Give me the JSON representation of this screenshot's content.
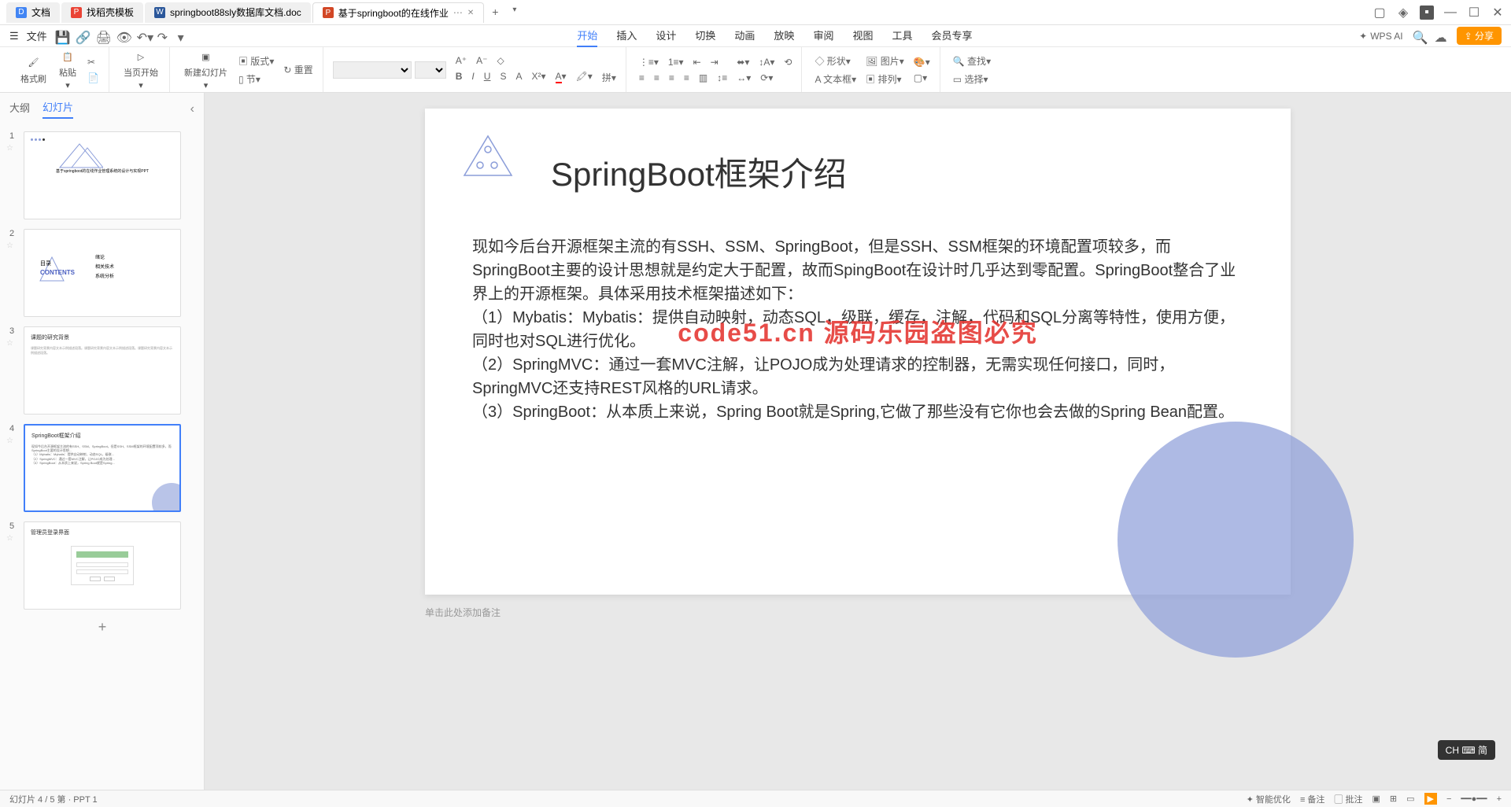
{
  "tabs": [
    {
      "icon": "D",
      "label": "文档"
    },
    {
      "icon": "P",
      "label": "找稻壳模板"
    },
    {
      "icon": "W",
      "label": "springboot88sly数据库文档.doc"
    },
    {
      "icon": "P",
      "label": "基于springboot的在线作业"
    }
  ],
  "menu": {
    "file": "文件",
    "items": [
      "开始",
      "插入",
      "设计",
      "切换",
      "动画",
      "放映",
      "审阅",
      "视图",
      "工具",
      "会员专享"
    ],
    "wpsai": "WPS AI",
    "share": "分享"
  },
  "toolbar": {
    "format_painter": "格式刷",
    "paste": "粘贴",
    "start_from": "当页开始",
    "new_slide": "新建幻灯片",
    "layout": "版式",
    "section": "节",
    "reset": "重置",
    "shape": "形状",
    "picture": "图片",
    "textbox": "文本框",
    "arrange": "排列",
    "find": "查找",
    "select": "选择"
  },
  "sidebar": {
    "outline": "大纲",
    "slides": "幻灯片"
  },
  "thumbs": [
    {
      "num": "1",
      "title": "基于springboot的在线作业管理系统的设计与实现PPT"
    },
    {
      "num": "2",
      "title": "目录",
      "contents": "CONTENTS",
      "items": [
        "绪论",
        "相关技术",
        "系统分析"
      ]
    },
    {
      "num": "3",
      "title": "课题的研究背景"
    },
    {
      "num": "4",
      "title": "SpringBoot框架介绍"
    },
    {
      "num": "5",
      "title": "管理员登录界面"
    }
  ],
  "slide": {
    "title": "SpringBoot框架介绍",
    "body_p1": "现如今后台开源框架主流的有SSH、SSM、SpringBoot，但是SSH、SSM框架的环境配置项较多，而SpringBoot主要的设计思想就是约定大于配置，故而SpingBoot在设计时几乎达到零配置。SpringBoot整合了业界上的开源框架。具体采用技术框架描述如下：",
    "body_p2": "（1）Mybatis：Mybatis：提供自动映射，动态SQL，级联，缓存，注解，代码和SQL分离等特性，使用方便，同时也对SQL进行优化。",
    "body_p3": "（2）SpringMVC：通过一套MVC注解，让POJO成为处理请求的控制器，无需实现任何接口，同时，SpringMVC还支持REST风格的URL请求。",
    "body_p4": "（3）SpringBoot：从本质上来说，Spring Boot就是Spring,它做了那些没有它你也会去做的Spring Bean配置。",
    "watermark": "code51.cn 源码乐园盗图必究"
  },
  "notes_placeholder": "单击此处添加备注",
  "ime": "CH ⌨ 简",
  "status": {
    "left": "幻灯片 4 / 5    第 · PPT      1"
  }
}
